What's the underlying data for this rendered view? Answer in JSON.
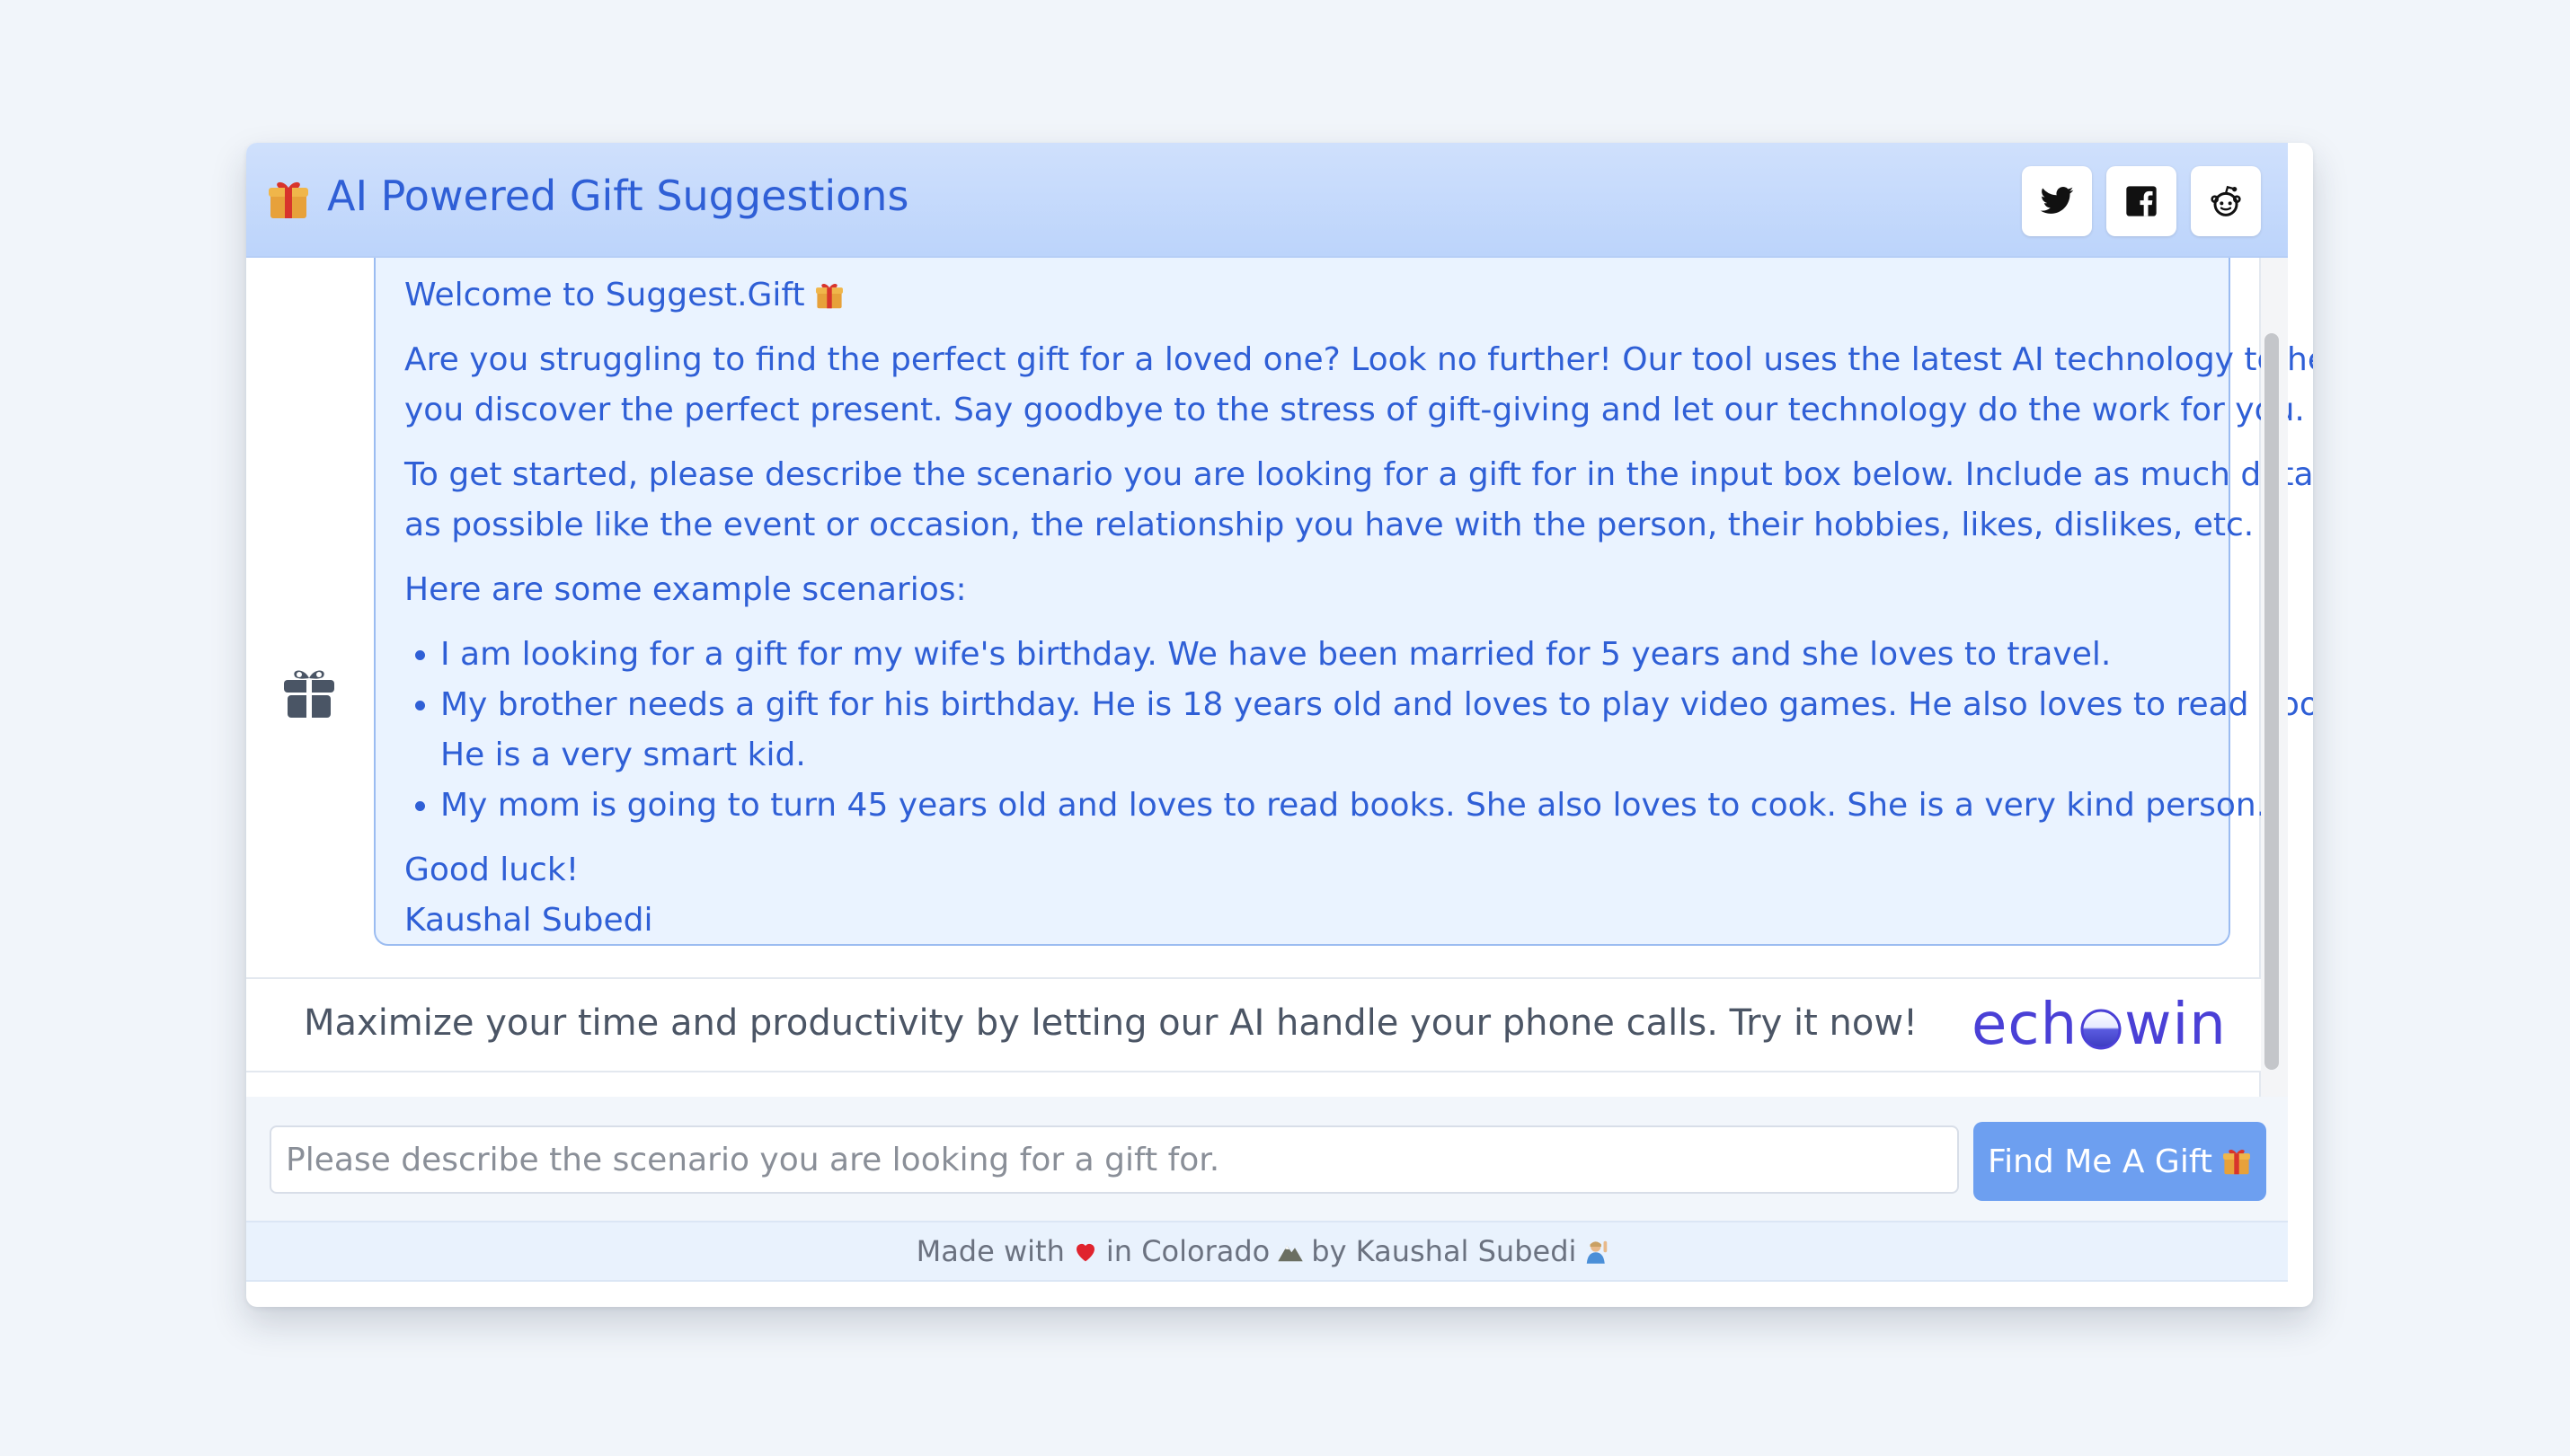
{
  "header": {
    "title": "AI Powered Gift Suggestions",
    "share": [
      "twitter-icon",
      "facebook-icon",
      "reddit-icon"
    ]
  },
  "message": {
    "welcome": "Welcome to Suggest.Gift",
    "intro": "Are you struggling to find the perfect gift for a loved one? Look no further! Our tool uses the latest AI technology to help",
    "intro2": "you discover the perfect present. Say goodbye to the stress of gift-giving and let our technology do the work for you.",
    "instructions": "To get started, please describe the scenario you are looking for a gift for in the input box below. Include as much details",
    "instructions2": "as possible like the event or occasion, the relationship you have with the person, their hobbies, likes, dislikes, etc.",
    "examples_heading": "Here are some example scenarios:",
    "examples": [
      "I am looking for a gift for my wife's birthday. We have been married for 5 years and she loves to travel.",
      "My brother needs a gift for his birthday. He is 18 years old and loves to play video games. He also loves to read books.",
      "He is a very smart kid.",
      "My mom is going to turn 45 years old and loves to read books. She also loves to cook. She is a very kind person."
    ],
    "closing": "Good luck!",
    "signature": "Kaushal Subedi"
  },
  "ad": {
    "text": "Maximize your time and productivity by letting our AI handle your phone calls. Try it now!",
    "brand_left": "ech",
    "brand_right": "win"
  },
  "input": {
    "placeholder": "Please describe the scenario you are looking for a gift for.",
    "value": ""
  },
  "button": {
    "label": "Find Me A Gift"
  },
  "footer": {
    "part1": "Made with",
    "part2": "in Colorado",
    "part3": "by Kaushal Subedi"
  },
  "colors": {
    "accent": "#2f5fd6",
    "bubble_bg": "#eaf3ff",
    "button": "#6d9ff0",
    "brand": "#4a40d6"
  }
}
